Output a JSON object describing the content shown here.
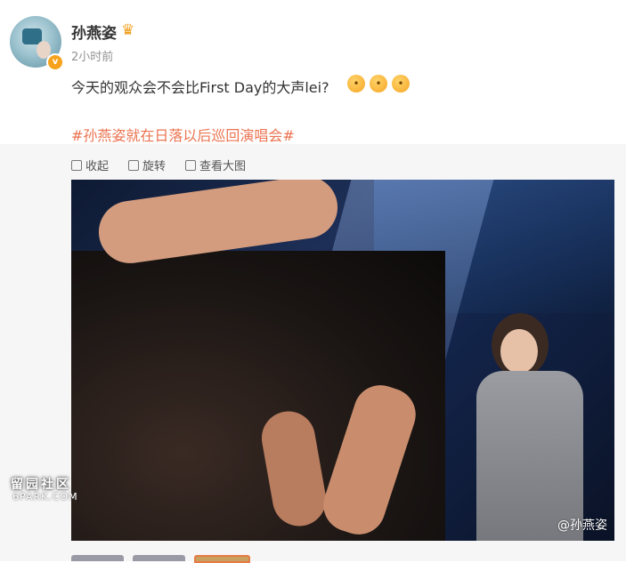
{
  "post": {
    "username": "孙燕姿",
    "time": "2小时前",
    "text": "今天的观众会不会比First Day的大声lei?",
    "hashtag": "#孙燕姿就在日落以后巡回演唱会#",
    "emojis": [
      "doge-think",
      "doge-think",
      "doge-think"
    ],
    "icons": {
      "verified": "v-badge-icon",
      "member": "crown-icon"
    }
  },
  "media_actions": {
    "collapse": "收起",
    "rotate": "旋转",
    "view_large": "查看大图"
  },
  "photo": {
    "watermark": "@孙燕姿",
    "site_watermark_cn": "留园社区",
    "site_watermark_en": "6PARK.COM"
  },
  "colors": {
    "hashtag": "#eb7350",
    "verified_badge": "#f7a21b"
  }
}
